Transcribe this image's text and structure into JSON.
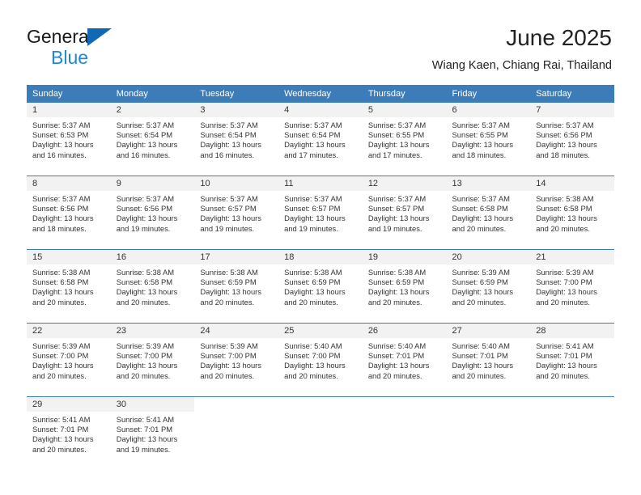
{
  "brand": {
    "name_top": "General",
    "name_bottom": "Blue",
    "accent_color": "#1268b3",
    "blue_text_color": "#1f86d8"
  },
  "header": {
    "title": "June 2025",
    "subtitle": "Wiang Kaen, Chiang Rai, Thailand"
  },
  "theme": {
    "header_row_bg": "#3b7cb9",
    "daynum_bg": "#f2f2f2",
    "text_color": "#333333"
  },
  "weekday_headers": [
    "Sunday",
    "Monday",
    "Tuesday",
    "Wednesday",
    "Thursday",
    "Friday",
    "Saturday"
  ],
  "labels": {
    "sunrise_prefix": "Sunrise:",
    "sunset_prefix": "Sunset:",
    "daylight_prefix": "Daylight:"
  },
  "weeks": [
    [
      {
        "day": "1",
        "sunrise": "Sunrise: 5:37 AM",
        "sunset": "Sunset: 6:53 PM",
        "daylight_line1": "Daylight: 13 hours",
        "daylight_line2": "and 16 minutes."
      },
      {
        "day": "2",
        "sunrise": "Sunrise: 5:37 AM",
        "sunset": "Sunset: 6:54 PM",
        "daylight_line1": "Daylight: 13 hours",
        "daylight_line2": "and 16 minutes."
      },
      {
        "day": "3",
        "sunrise": "Sunrise: 5:37 AM",
        "sunset": "Sunset: 6:54 PM",
        "daylight_line1": "Daylight: 13 hours",
        "daylight_line2": "and 16 minutes."
      },
      {
        "day": "4",
        "sunrise": "Sunrise: 5:37 AM",
        "sunset": "Sunset: 6:54 PM",
        "daylight_line1": "Daylight: 13 hours",
        "daylight_line2": "and 17 minutes."
      },
      {
        "day": "5",
        "sunrise": "Sunrise: 5:37 AM",
        "sunset": "Sunset: 6:55 PM",
        "daylight_line1": "Daylight: 13 hours",
        "daylight_line2": "and 17 minutes."
      },
      {
        "day": "6",
        "sunrise": "Sunrise: 5:37 AM",
        "sunset": "Sunset: 6:55 PM",
        "daylight_line1": "Daylight: 13 hours",
        "daylight_line2": "and 18 minutes."
      },
      {
        "day": "7",
        "sunrise": "Sunrise: 5:37 AM",
        "sunset": "Sunset: 6:56 PM",
        "daylight_line1": "Daylight: 13 hours",
        "daylight_line2": "and 18 minutes."
      }
    ],
    [
      {
        "day": "8",
        "sunrise": "Sunrise: 5:37 AM",
        "sunset": "Sunset: 6:56 PM",
        "daylight_line1": "Daylight: 13 hours",
        "daylight_line2": "and 18 minutes."
      },
      {
        "day": "9",
        "sunrise": "Sunrise: 5:37 AM",
        "sunset": "Sunset: 6:56 PM",
        "daylight_line1": "Daylight: 13 hours",
        "daylight_line2": "and 19 minutes."
      },
      {
        "day": "10",
        "sunrise": "Sunrise: 5:37 AM",
        "sunset": "Sunset: 6:57 PM",
        "daylight_line1": "Daylight: 13 hours",
        "daylight_line2": "and 19 minutes."
      },
      {
        "day": "11",
        "sunrise": "Sunrise: 5:37 AM",
        "sunset": "Sunset: 6:57 PM",
        "daylight_line1": "Daylight: 13 hours",
        "daylight_line2": "and 19 minutes."
      },
      {
        "day": "12",
        "sunrise": "Sunrise: 5:37 AM",
        "sunset": "Sunset: 6:57 PM",
        "daylight_line1": "Daylight: 13 hours",
        "daylight_line2": "and 19 minutes."
      },
      {
        "day": "13",
        "sunrise": "Sunrise: 5:37 AM",
        "sunset": "Sunset: 6:58 PM",
        "daylight_line1": "Daylight: 13 hours",
        "daylight_line2": "and 20 minutes."
      },
      {
        "day": "14",
        "sunrise": "Sunrise: 5:38 AM",
        "sunset": "Sunset: 6:58 PM",
        "daylight_line1": "Daylight: 13 hours",
        "daylight_line2": "and 20 minutes."
      }
    ],
    [
      {
        "day": "15",
        "sunrise": "Sunrise: 5:38 AM",
        "sunset": "Sunset: 6:58 PM",
        "daylight_line1": "Daylight: 13 hours",
        "daylight_line2": "and 20 minutes."
      },
      {
        "day": "16",
        "sunrise": "Sunrise: 5:38 AM",
        "sunset": "Sunset: 6:58 PM",
        "daylight_line1": "Daylight: 13 hours",
        "daylight_line2": "and 20 minutes."
      },
      {
        "day": "17",
        "sunrise": "Sunrise: 5:38 AM",
        "sunset": "Sunset: 6:59 PM",
        "daylight_line1": "Daylight: 13 hours",
        "daylight_line2": "and 20 minutes."
      },
      {
        "day": "18",
        "sunrise": "Sunrise: 5:38 AM",
        "sunset": "Sunset: 6:59 PM",
        "daylight_line1": "Daylight: 13 hours",
        "daylight_line2": "and 20 minutes."
      },
      {
        "day": "19",
        "sunrise": "Sunrise: 5:38 AM",
        "sunset": "Sunset: 6:59 PM",
        "daylight_line1": "Daylight: 13 hours",
        "daylight_line2": "and 20 minutes."
      },
      {
        "day": "20",
        "sunrise": "Sunrise: 5:39 AM",
        "sunset": "Sunset: 6:59 PM",
        "daylight_line1": "Daylight: 13 hours",
        "daylight_line2": "and 20 minutes."
      },
      {
        "day": "21",
        "sunrise": "Sunrise: 5:39 AM",
        "sunset": "Sunset: 7:00 PM",
        "daylight_line1": "Daylight: 13 hours",
        "daylight_line2": "and 20 minutes."
      }
    ],
    [
      {
        "day": "22",
        "sunrise": "Sunrise: 5:39 AM",
        "sunset": "Sunset: 7:00 PM",
        "daylight_line1": "Daylight: 13 hours",
        "daylight_line2": "and 20 minutes."
      },
      {
        "day": "23",
        "sunrise": "Sunrise: 5:39 AM",
        "sunset": "Sunset: 7:00 PM",
        "daylight_line1": "Daylight: 13 hours",
        "daylight_line2": "and 20 minutes."
      },
      {
        "day": "24",
        "sunrise": "Sunrise: 5:39 AM",
        "sunset": "Sunset: 7:00 PM",
        "daylight_line1": "Daylight: 13 hours",
        "daylight_line2": "and 20 minutes."
      },
      {
        "day": "25",
        "sunrise": "Sunrise: 5:40 AM",
        "sunset": "Sunset: 7:00 PM",
        "daylight_line1": "Daylight: 13 hours",
        "daylight_line2": "and 20 minutes."
      },
      {
        "day": "26",
        "sunrise": "Sunrise: 5:40 AM",
        "sunset": "Sunset: 7:01 PM",
        "daylight_line1": "Daylight: 13 hours",
        "daylight_line2": "and 20 minutes."
      },
      {
        "day": "27",
        "sunrise": "Sunrise: 5:40 AM",
        "sunset": "Sunset: 7:01 PM",
        "daylight_line1": "Daylight: 13 hours",
        "daylight_line2": "and 20 minutes."
      },
      {
        "day": "28",
        "sunrise": "Sunrise: 5:41 AM",
        "sunset": "Sunset: 7:01 PM",
        "daylight_line1": "Daylight: 13 hours",
        "daylight_line2": "and 20 minutes."
      }
    ],
    [
      {
        "day": "29",
        "sunrise": "Sunrise: 5:41 AM",
        "sunset": "Sunset: 7:01 PM",
        "daylight_line1": "Daylight: 13 hours",
        "daylight_line2": "and 20 minutes."
      },
      {
        "day": "30",
        "sunrise": "Sunrise: 5:41 AM",
        "sunset": "Sunset: 7:01 PM",
        "daylight_line1": "Daylight: 13 hours",
        "daylight_line2": "and 19 minutes."
      },
      {
        "day": "",
        "sunrise": "",
        "sunset": "",
        "daylight_line1": "",
        "daylight_line2": ""
      },
      {
        "day": "",
        "sunrise": "",
        "sunset": "",
        "daylight_line1": "",
        "daylight_line2": ""
      },
      {
        "day": "",
        "sunrise": "",
        "sunset": "",
        "daylight_line1": "",
        "daylight_line2": ""
      },
      {
        "day": "",
        "sunrise": "",
        "sunset": "",
        "daylight_line1": "",
        "daylight_line2": ""
      },
      {
        "day": "",
        "sunrise": "",
        "sunset": "",
        "daylight_line1": "",
        "daylight_line2": ""
      }
    ]
  ]
}
